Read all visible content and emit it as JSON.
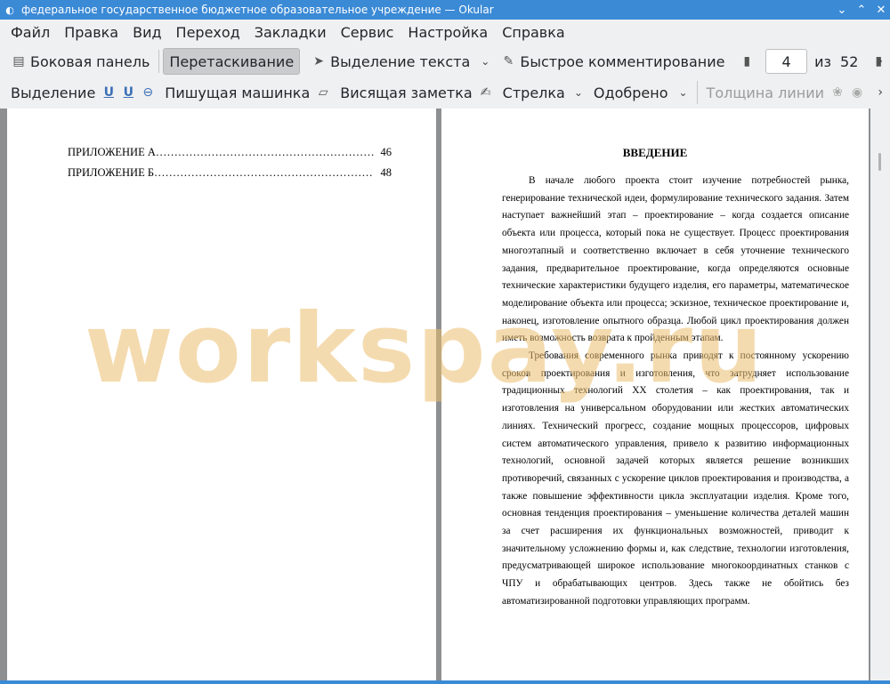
{
  "window": {
    "title": "федеральное государственное бюджетное образовательное учреждение  — Okular",
    "buttons": [
      "⌄",
      "⌃",
      "✕"
    ]
  },
  "menu": [
    "Файл",
    "Правка",
    "Вид",
    "Переход",
    "Закладки",
    "Сервис",
    "Настройка",
    "Справка"
  ],
  "toolbar1": {
    "sidebar": "Боковая панель",
    "drag": "Перетаскивание",
    "text_select": "Выделение текста",
    "quick_comment": "Быстрое комментирование",
    "page_current": "4",
    "page_of": "из",
    "page_total": "52"
  },
  "toolbar2": {
    "selection": "Выделение",
    "typewriter": "Пишущая машинка",
    "hanging_note": "Висящая заметка",
    "arrow": "Стрелка",
    "approved": "Одобрено",
    "line_width": "Толщина линии"
  },
  "page_left": {
    "toc": [
      {
        "label": "ПРИЛОЖЕНИЕ А…………………………………………………….",
        "page": "46"
      },
      {
        "label": "ПРИЛОЖЕНИЕ Б……………………………………………………..",
        "page": "48"
      }
    ]
  },
  "page_right": {
    "heading": "ВВЕДЕНИЕ",
    "paragraphs": [
      "В начале любого проекта стоит изучение потребностей рынка, генерирование технической идеи, формулирование технического задания. Затем наступает важнейший этап – проектирование – когда создается описание объекта или процесса, который пока не существует. Процесс проектирования многоэтапный и соответственно включает в себя уточнение технического задания, предварительное проектирование, когда определяются основные технические характеристики будущего изделия, его параметры, математическое моделирование объекта или процесса; эскизное, техническое проектирование и, наконец, изготовление опытного образца. Любой цикл проектирования должен иметь возможность возврата к пройденным этапам.",
      "Требования современного рынка приводят к постоянному ускорению сроков проектирования и изготовления, что затрудняет использование традиционных технологий XX столетия – как проектирования, так и изготовления на универсальном оборудовании или жестких автоматических линиях. Технический прогресс, создание мощных процессоров, цифровых систем автоматического управления, привело к развитию информационных технологий, основной задачей которых является решение возникших противоречий, связанных с ускорение циклов проектирования и производства, а также повышение эффективности цикла эксплуатации изделия. Кроме того, основная тенденция проектирования – уменьшение количества деталей машин за счет расширения их функциональных возможностей, приводит к значительному усложнению формы и, как следствие, технологии изготовления, предусматривающей широкое использование многокоординатных станков с ЧПУ и обрабатывающих центров. Здесь также не обойтись без автоматизированной подготовки управляющих программ."
    ]
  },
  "watermark": "workspay.ru",
  "colors": {
    "titlebar": "#3b8ad6",
    "watermark": "#ebbe6e"
  }
}
